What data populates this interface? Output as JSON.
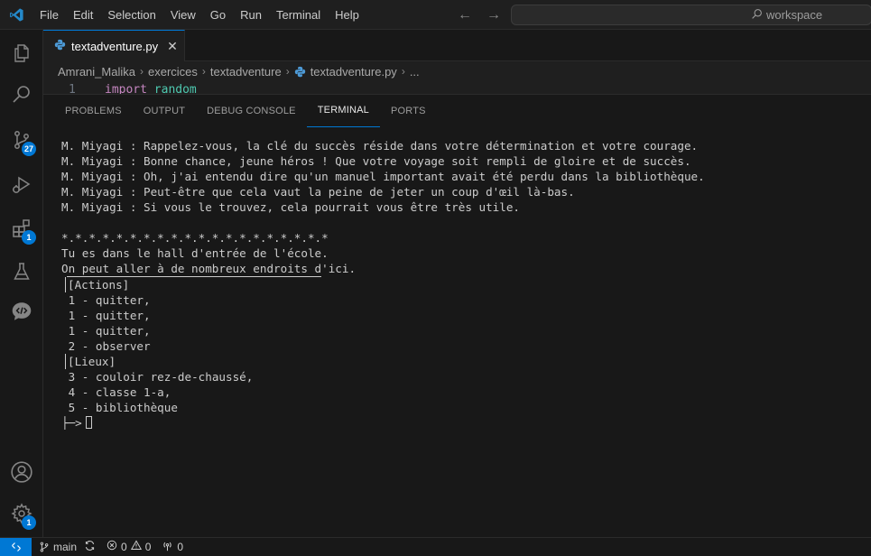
{
  "menu": [
    "File",
    "Edit",
    "Selection",
    "View",
    "Go",
    "Run",
    "Terminal",
    "Help"
  ],
  "search": {
    "placeholder": "workspace"
  },
  "activity": {
    "source_control_badge": "27",
    "extensions_badge": "1",
    "settings_badge": "1"
  },
  "tab": {
    "label": "textadventure.py"
  },
  "breadcrumb": [
    "Amrani_Malika",
    "exercices",
    "textadventure",
    "textadventure.py",
    "..."
  ],
  "editor": {
    "line_number": "1",
    "keyword": "import",
    "module": "random"
  },
  "panel_tabs": [
    "PROBLEMS",
    "OUTPUT",
    "DEBUG CONSOLE",
    "TERMINAL",
    "PORTS"
  ],
  "terminal": {
    "dialogue": [
      "M. Miyagi : Rappelez-vous, la clé du succès réside dans votre détermination et votre courage.",
      "M. Miyagi : Bonne chance, jeune héros ! Que votre voyage soit rempli de gloire et de succès.",
      "M. Miyagi : Oh, j'ai entendu dire qu'un manuel important avait été perdu dans la bibliothèque.",
      "M. Miyagi : Peut-être que cela vaut la peine de jeter un coup d'œil là-bas.",
      "M. Miyagi : Si vous le trouvez, cela pourrait vous être très utile."
    ],
    "separator": "*.*.*.*.*.*.*.*.*.*.*.*.*.*.*.*.*.*.*.*",
    "location_lines": [
      "Tu es dans le hall d'entrée de l'école.",
      "On peut aller à de nombreux endroits d'ici."
    ],
    "actions_header": "[Actions]",
    "actions": [
      "1 - quitter,",
      "1 - quitter,",
      "1 - quitter,",
      "2 - observer"
    ],
    "places_header": "[Lieux]",
    "places": [
      "3 - couloir rez-de-chaussé,",
      "4 - classe 1-a,",
      "5 - bibliothèque"
    ],
    "prompt": "├─>"
  },
  "status": {
    "branch": "main",
    "errors": "0",
    "warnings": "0",
    "ports": "0"
  },
  "colors": {
    "accent": "#0078d4",
    "background": "#181818"
  }
}
